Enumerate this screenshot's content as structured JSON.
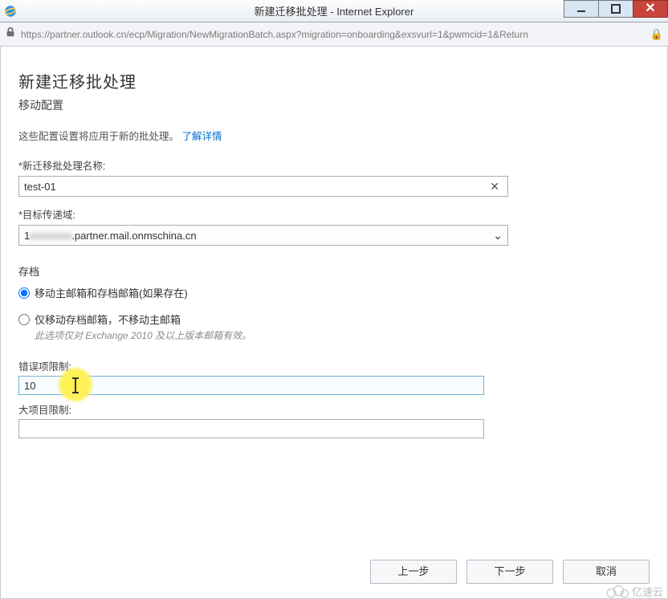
{
  "window": {
    "title": "新建迁移批处理 - Internet Explorer"
  },
  "address": {
    "url": "https://partner.outlook.cn/ecp/Migration/NewMigrationBatch.aspx?migration=onboarding&exsvurl=1&pwmcid=1&Return"
  },
  "page": {
    "heading": "新建迁移批处理",
    "subheading": "移动配置",
    "description_prefix": "这些配置设置将应用于新的批处理。",
    "learn_more": "了解详情",
    "fields": {
      "batch_name_label": "*新迁移批处理名称:",
      "batch_name_value": "test-01",
      "target_domain_label": "*目标传递域:",
      "target_domain_value_prefix": "1",
      "target_domain_value_suffix": ".partner.mail.onmschina.cn"
    },
    "archive": {
      "section_label": "存档",
      "option1_label": "移动主邮箱和存档邮箱(如果存在)",
      "option2_label": "仅移动存档邮箱，不移动主邮箱",
      "option2_note": "此选项仅对 Exchange 2010 及以上版本邮箱有效。",
      "selected": "option1"
    },
    "limits": {
      "bad_item_label": "错误项限制:",
      "bad_item_value": "10",
      "large_item_label": "大项目限制:",
      "large_item_value": ""
    },
    "buttons": {
      "back": "上一步",
      "next": "下一步",
      "cancel": "取消"
    }
  },
  "watermark": "亿速云"
}
